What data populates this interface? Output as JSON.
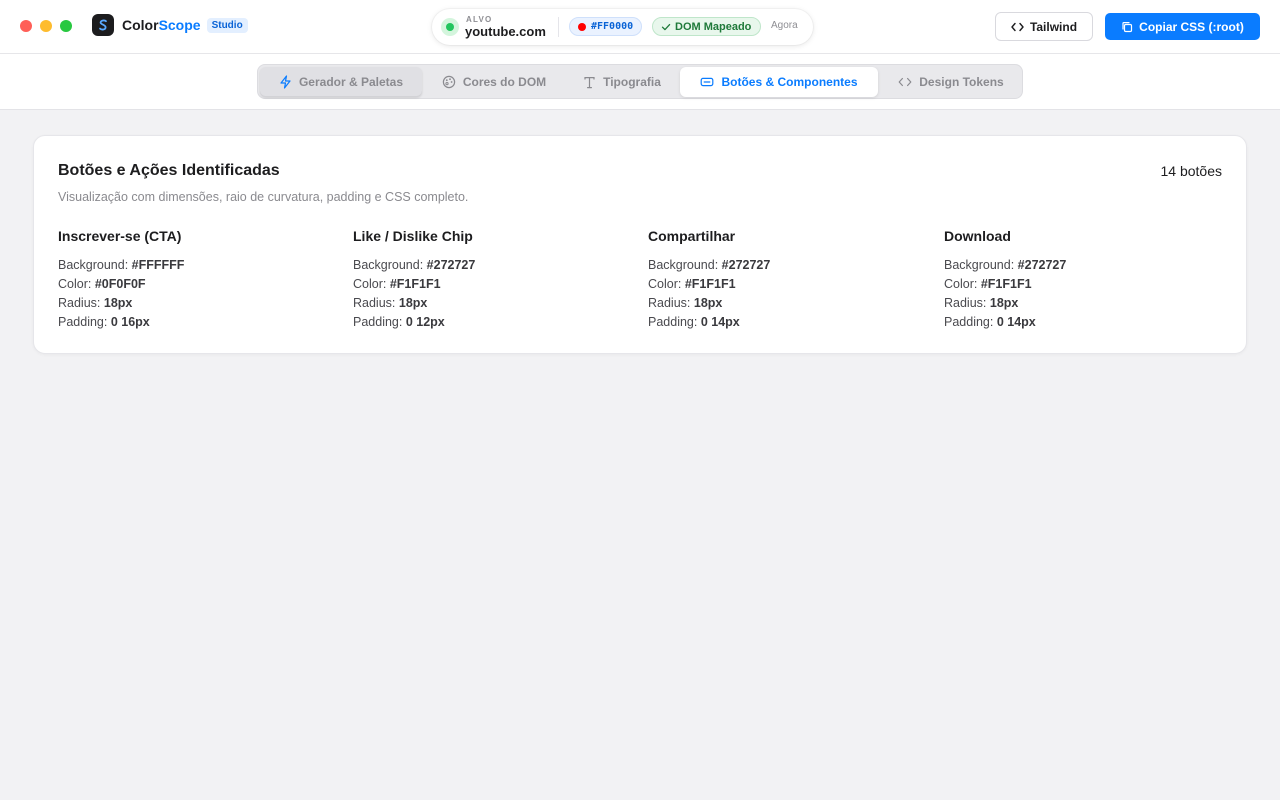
{
  "app": {
    "name_main": "Color",
    "name_accent": "Scope",
    "badge": "Studio"
  },
  "target": {
    "label": "ALVO",
    "domain": "youtube.com",
    "primary_color": "#FF0000",
    "status": "DOM Mapeado",
    "time": "Agora"
  },
  "toolbar": {
    "tailwind_label": "Tailwind",
    "copy_label": "Copiar CSS (:root)"
  },
  "tabs": [
    {
      "label": "Gerador & Paletas",
      "icon": "bolt-icon",
      "state": "pressed"
    },
    {
      "label": "Cores do DOM",
      "icon": "palette-icon",
      "state": "inactive"
    },
    {
      "label": "Tipografia",
      "icon": "type-icon",
      "state": "inactive"
    },
    {
      "label": "Botões & Componentes",
      "icon": "button-component-icon",
      "state": "active"
    },
    {
      "label": "Design Tokens",
      "icon": "code-icon",
      "state": "inactive"
    }
  ],
  "buttons_panel": {
    "title": "Botões e Ações Identificadas",
    "subtitle": "Visualização com dimensões, raio de curvatura, padding e CSS completo.",
    "count": "14 botões",
    "labels": {
      "background": "Background:",
      "color": "Color:",
      "radius": "Radius:",
      "padding": "Padding:"
    },
    "items": [
      {
        "name": "Inscrever-se (CTA)",
        "background": "#FFFFFF",
        "color": "#0F0F0F",
        "radius": "18px",
        "padding": "0 16px"
      },
      {
        "name": "Like / Dislike Chip",
        "background": "#272727",
        "color": "#F1F1F1",
        "radius": "18px",
        "padding": "0 12px"
      },
      {
        "name": "Compartilhar",
        "background": "#272727",
        "color": "#F1F1F1",
        "radius": "18px",
        "padding": "0 14px"
      },
      {
        "name": "Download",
        "background": "#272727",
        "color": "#F1F1F1",
        "radius": "18px",
        "padding": "0 14px"
      }
    ]
  },
  "colors": {
    "accent": "#0a7cff",
    "live": "#22c55e",
    "page_bg": "#f2f2f4"
  }
}
